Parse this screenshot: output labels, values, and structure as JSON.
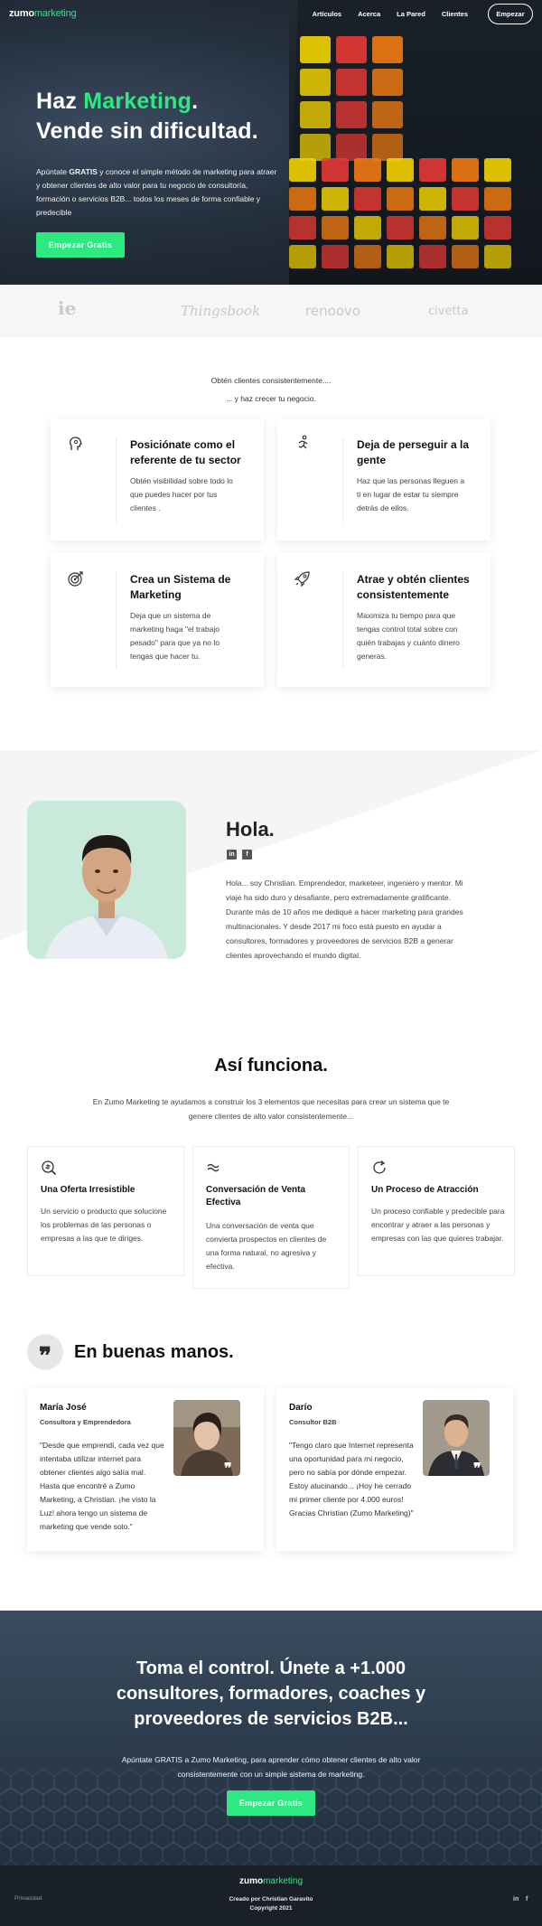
{
  "nav": {
    "logo_main": "zumo",
    "logo_accent": "marketing",
    "links": [
      "Artículos",
      "Acerca",
      "La Pared",
      "Clientes"
    ],
    "cta": "Empezar"
  },
  "hero": {
    "title_pre": "Haz ",
    "title_accent": "Marketing",
    "title_post": ".",
    "title_line2": "Vende sin dificultad.",
    "text_pre": "Apúntate ",
    "text_bold": "GRATIS",
    "text_post": " y conoce el simple método de marketing para atraer y obtener clientes de alto valor para tu negocio de consultoría, formación o servicios B2B... todos los meses de forma confiable y predecible",
    "button": "Empezar Gratis"
  },
  "logos": [
    "ie",
    "Thingsbook",
    "renoovo",
    "civetta"
  ],
  "benefits": {
    "intro_line1": "Obtén clientes consistentemente....",
    "intro_line2": "... y haz crecer tu negocio.",
    "cards": [
      {
        "title": "Posiciónate como el referente de tu sector",
        "text": "Obtén visibilidad sobre todo lo que puedes hacer por tus clientes .",
        "icon": "head-icon"
      },
      {
        "title": "Deja de perseguir a la gente",
        "text": "Haz que las personas lleguen a ti en lugar de estar tu siempre detrás de ellos.",
        "icon": "runner-icon"
      },
      {
        "title": "Crea un Sistema de Marketing",
        "text": "Deja que un sistema de marketing haga \"el trabajo pesado\" para que ya no lo tengas que hacer tu.",
        "icon": "target-icon"
      },
      {
        "title": "Atrae y obtén clientes consistentemente",
        "text": "Maximiza tu tiempo para que tengas control total sobre con quién trabajas y cuánto dinero generas.",
        "icon": "rocket-icon"
      }
    ]
  },
  "about": {
    "title": "Hola.",
    "social": [
      "in",
      "f"
    ],
    "text": "Hola... soy Christian. Emprendedor, marketeer, ingeniero y mentor. Mi viaje ha sido duro y desafiante, pero extremadamente gratificante. Durante más de 10 años me dediqué a hacer marketing para grandes multinacionales. Y desde 2017 mi foco está puesto en ayudar a consultores, formadores y proveedores de servicios B2B a generar clientes aprovechando el mundo digital."
  },
  "how": {
    "title": "Así funciona.",
    "subtitle": "En Zumo Marketing te ayudamos a construir los 3 elementos que necesitas para crear un sistema que te genere clientes de alto valor consistentemente...",
    "items": [
      {
        "title": "Una Oferta Irresistible",
        "text": "Un servicio o producto que solucione los problemas de las personas o empresas a las que te diriges.",
        "icon": "search-icon"
      },
      {
        "title": "Conversación de Venta Efectiva",
        "text": "Una conversación de venta que convierta prospectos en clientes de una forma natural, no agresiva y efectiva.",
        "icon": "wave-icon"
      },
      {
        "title": "Un Proceso de Atracción",
        "text": "Un proceso confiable y predecible para encontrar y atraer a las personas y empresas con las que quieres trabajar.",
        "icon": "refresh-icon"
      }
    ]
  },
  "testimonials": {
    "quote_mark": "❞",
    "title": "En buenas manos.",
    "items": [
      {
        "name": "María José",
        "role": "Consultora y Emprendedora",
        "quote": "\"Desde que emprendí, cada vez que intentaba utilizar internet para obtener clientes algo salía mal. Hasta que encontré a Zumo Marketing, a Christian. ¡he visto la Luz! ahora tengo un sistema de marketing que vende solo.\""
      },
      {
        "name": "Darío",
        "role": "Consultor B2B",
        "quote": "\"Tengo claro que Internet representa una oportunidad para mi negocio, pero no sabía por dónde empezar. Estoy alucinando... ¡Hoy he cerrado mi primer cliente por 4.000 euros! Gracias Christian (Zumo Marketing)\""
      }
    ]
  },
  "cta": {
    "title": "Toma el control. Únete a +1.000 consultores, formadores, coaches y proveedores de servicios B2B...",
    "text": "Apúntate GRATIS a Zumo Marketing, para aprender cómo obtener clientes de alto valor consistentemente con un simple sistema de marketing.",
    "button": "Empezar Gratis"
  },
  "footer": {
    "privacy": "Privacidad",
    "logo_main": "zumo",
    "logo_accent": "marketing",
    "credit_line1": "Creado por Christian Garavito",
    "credit_line2": "Copyright 2021",
    "social": [
      "in",
      "f"
    ]
  },
  "colors": {
    "accent": "#2ee882",
    "hero_dark": "#1f2833",
    "cta_bg": "#2e3e50",
    "footer_bg": "#1a2028"
  }
}
